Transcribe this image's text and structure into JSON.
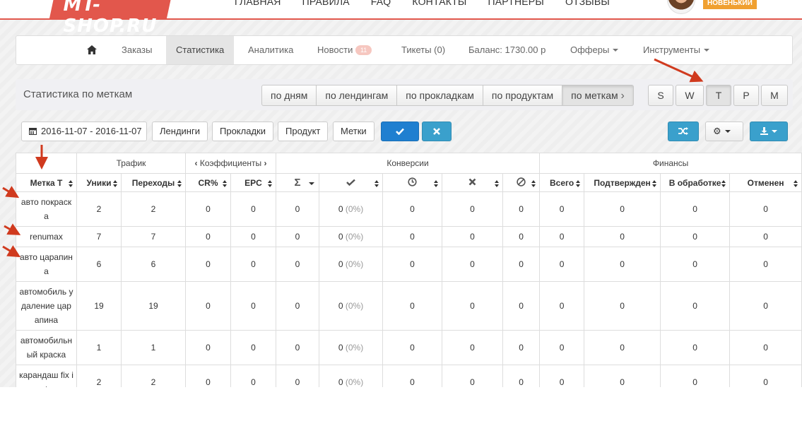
{
  "header": {
    "logo": "MT-SHOP.RU",
    "nav": [
      "ГЛАВНАЯ",
      "ПРАВИЛА",
      "FAQ",
      "КОНТАКТЫ",
      "ПАРТНЕРЫ",
      "ОТЗЫВЫ"
    ],
    "user_rank": "НОВЕНЬКИЙ"
  },
  "menu": {
    "orders": "Заказы",
    "stats": "Статистика",
    "analytics": "Аналитика",
    "news": "Новости",
    "news_badge": "11",
    "tickets": "Тикеты (0)",
    "balance": "Баланс: 1730.00 р",
    "offers": "Офферы",
    "tools": "Инструменты"
  },
  "stats": {
    "title": "Статистика по меткам",
    "groupings": [
      "по дням",
      "по лендингам",
      "по прокладкам",
      "по продуктам",
      "по меткам"
    ],
    "active_grouping": "по меткам",
    "periods": [
      "S",
      "W",
      "T",
      "P",
      "M"
    ],
    "active_period": "T"
  },
  "toolbar": {
    "date_range": "2016-11-07 - 2016-11-07",
    "landings": "Лендинги",
    "prelands": "Прокладки",
    "product": "Продукт",
    "tags": "Метки"
  },
  "table": {
    "groups": {
      "traffic": "Трафик",
      "coefficients": "Коэффициенты",
      "conversions": "Конверсии",
      "finance": "Финансы"
    },
    "columns": {
      "tag": "Метка Т",
      "uniques": "Уники",
      "clicks": "Переходы",
      "cr": "CR%",
      "epc": "EPC",
      "sum": "Σ",
      "approved_icon": "check-icon",
      "hold_icon": "clock-icon",
      "rejected_icon": "x-icon",
      "trash_icon": "ban-icon",
      "fin_total": "Всего",
      "fin_confirmed": "Подтвержден",
      "fin_processing": "В обработке",
      "fin_cancelled": "Отменен"
    },
    "rows": [
      {
        "tag": "авто покраска",
        "uniques": "2",
        "clicks": "2",
        "cr": "0",
        "epc": "0",
        "sum": "0",
        "approved": "0",
        "approved_pct": "(0%)",
        "hold": "0",
        "rejected": "0",
        "trash": "0",
        "total": "0",
        "confirmed": "0",
        "processing": "0",
        "cancelled": "0"
      },
      {
        "tag": "renumax",
        "uniques": "7",
        "clicks": "7",
        "cr": "0",
        "epc": "0",
        "sum": "0",
        "approved": "0",
        "approved_pct": "(0%)",
        "hold": "0",
        "rejected": "0",
        "trash": "0",
        "total": "0",
        "confirmed": "0",
        "processing": "0",
        "cancelled": "0"
      },
      {
        "tag": "авто царапина",
        "uniques": "6",
        "clicks": "6",
        "cr": "0",
        "epc": "0",
        "sum": "0",
        "approved": "0",
        "approved_pct": "(0%)",
        "hold": "0",
        "rejected": "0",
        "trash": "0",
        "total": "0",
        "confirmed": "0",
        "processing": "0",
        "cancelled": "0"
      },
      {
        "tag": "автомобиль удаление царапина",
        "uniques": "19",
        "clicks": "19",
        "cr": "0",
        "epc": "0",
        "sum": "0",
        "approved": "0",
        "approved_pct": "(0%)",
        "hold": "0",
        "rejected": "0",
        "trash": "0",
        "total": "0",
        "confirmed": "0",
        "processing": "0",
        "cancelled": "0"
      },
      {
        "tag": "автомобильный краска",
        "uniques": "1",
        "clicks": "1",
        "cr": "0",
        "epc": "0",
        "sum": "0",
        "approved": "0",
        "approved_pct": "(0%)",
        "hold": "0",
        "rejected": "0",
        "trash": "0",
        "total": "0",
        "confirmed": "0",
        "processing": "0",
        "cancelled": "0"
      },
      {
        "tag": "карандаш fix it",
        "uniques": "2",
        "clicks": "2",
        "cr": "0",
        "epc": "0",
        "sum": "0",
        "approved": "0",
        "approved_pct": "(0%)",
        "hold": "0",
        "rejected": "0",
        "trash": "0",
        "total": "0",
        "confirmed": "0",
        "processing": "0",
        "cancelled": "0"
      }
    ]
  },
  "colors": {
    "brand": "#e2574c",
    "primary_blue": "#1f7fd0",
    "teal": "#3aa0cc",
    "badge_orange": "#f0a030",
    "annotation_arrow": "#d03a1e"
  }
}
